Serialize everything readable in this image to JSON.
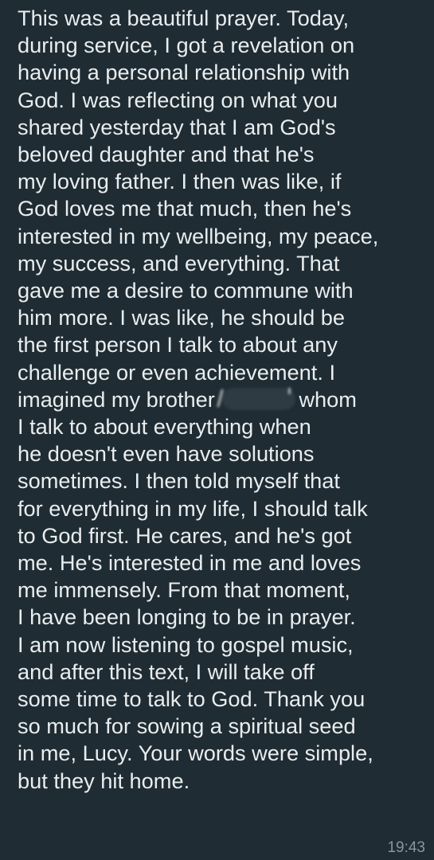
{
  "message": {
    "lines": [
      "This was a beautiful prayer. Today,",
      "during service, I got a revelation on",
      "having a personal relationship with",
      "God. I was reflecting on what you",
      "shared yesterday that I am God's",
      "beloved daughter and that he's",
      "my loving father. I then was like, if",
      "God loves me that much, then he's",
      "interested in my wellbeing, my peace,",
      "my success, and everything. That",
      "gave me a desire to commune with",
      "him more. I was like, he should be",
      "the first person I talk to about any",
      "challenge or even achievement. I",
      "imagined my brother",
      "whom",
      "I talk to about everything when",
      "he doesn't even have solutions",
      "sometimes. I then told myself that",
      "for everything in my life, I should talk",
      "to God first. He cares, and he's got",
      "me. He's interested in me and loves",
      "me immensely. From that moment,",
      "I have been longing to be in prayer.",
      "I am now listening to gospel music,",
      "and after this text, I will take off",
      "some time to talk to God. Thank you",
      "so much for sowing a spiritual seed",
      "in me, Lucy. Your words were simple,",
      "but they hit home."
    ],
    "time": "19:43"
  },
  "colors": {
    "bubble_background": "#1f2c33",
    "text": "#e9edef",
    "timestamp": "#8696a0"
  }
}
